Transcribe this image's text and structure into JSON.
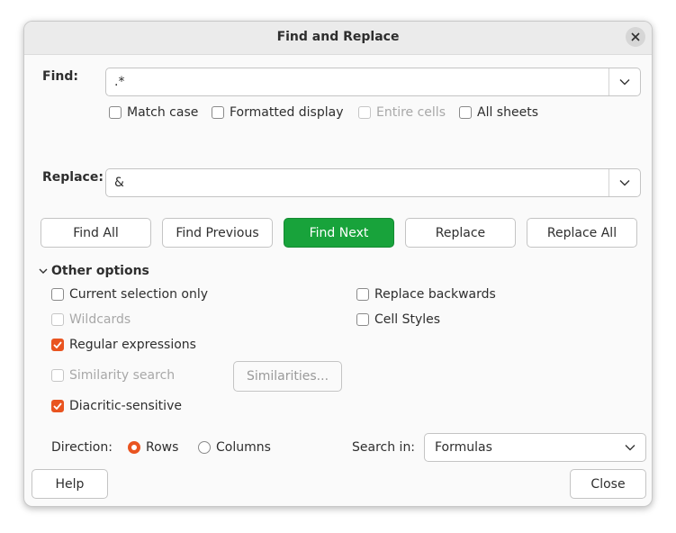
{
  "dialog": {
    "title": "Find and Replace"
  },
  "find": {
    "label": "Find:",
    "value": ".*"
  },
  "find_options": {
    "match_case": {
      "label": "Match case",
      "checked": false,
      "enabled": true
    },
    "formatted_display": {
      "label": "Formatted display",
      "checked": false,
      "enabled": true
    },
    "entire_cells": {
      "label": "Entire cells",
      "checked": false,
      "enabled": false
    },
    "all_sheets": {
      "label": "All sheets",
      "checked": false,
      "enabled": true
    }
  },
  "replace": {
    "label": "Replace:",
    "value": "&"
  },
  "buttons": {
    "find_all": "Find All",
    "find_previous": "Find Previous",
    "find_next": "Find Next",
    "replace": "Replace",
    "replace_all": "Replace All"
  },
  "other_options": {
    "label": "Other options",
    "current_selection_only": {
      "label": "Current selection only",
      "checked": false,
      "enabled": true
    },
    "wildcards": {
      "label": "Wildcards",
      "checked": false,
      "enabled": false
    },
    "regular_expressions": {
      "label": "Regular expressions",
      "checked": true,
      "enabled": true
    },
    "similarity_search": {
      "label": "Similarity search",
      "checked": false,
      "enabled": false
    },
    "similarities_button": "Similarities...",
    "diacritic_sensitive": {
      "label": "Diacritic-sensitive",
      "checked": true,
      "enabled": true
    },
    "replace_backwards": {
      "label": "Replace backwards",
      "checked": false,
      "enabled": true
    },
    "cell_styles": {
      "label": "Cell Styles",
      "checked": false,
      "enabled": true
    }
  },
  "direction": {
    "label": "Direction:",
    "rows": {
      "label": "Rows",
      "selected": true
    },
    "columns": {
      "label": "Columns",
      "selected": false
    }
  },
  "search_in": {
    "label": "Search in:",
    "value": "Formulas"
  },
  "footer": {
    "help": "Help",
    "close": "Close"
  },
  "colors": {
    "accent": "#e95420",
    "primary_button": "#18a33b"
  }
}
